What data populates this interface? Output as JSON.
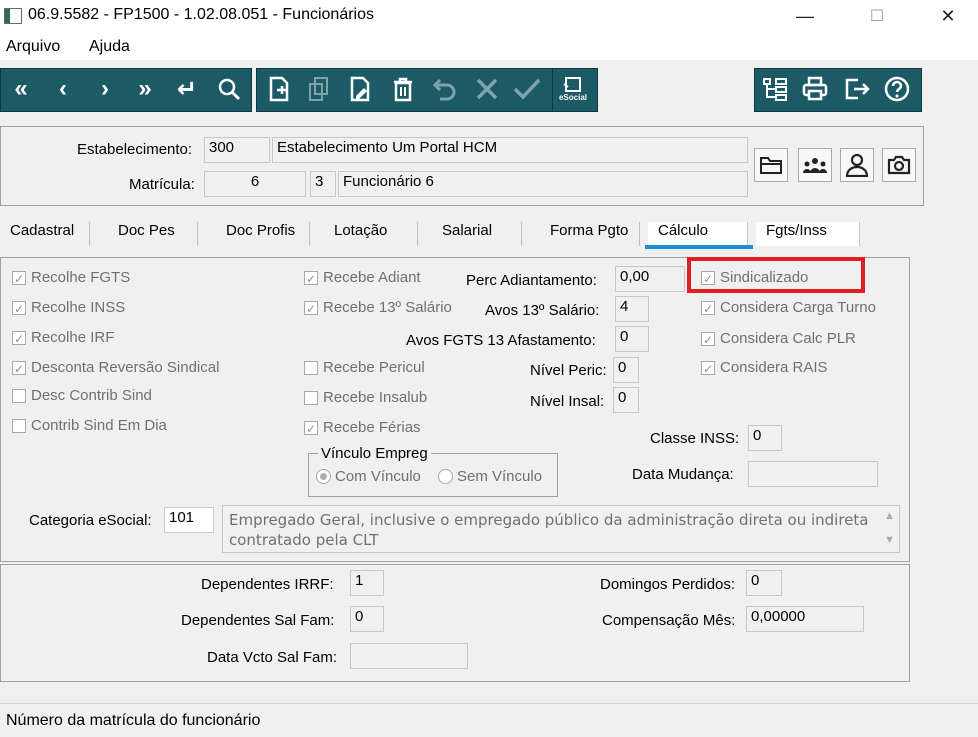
{
  "window": {
    "title": "06.9.5582 - FP1500 - 1.02.08.051 - Funcionários",
    "minimize": "—",
    "maximize": "☐",
    "close": "✕"
  },
  "menu": {
    "arquivo": "Arquivo",
    "ajuda": "Ajuda"
  },
  "toolbar": {
    "nav": [
      "«",
      "‹",
      "›",
      "»",
      "↵",
      "🔍"
    ],
    "edit": [
      "new-doc-icon",
      "copy-icon",
      "edit-icon",
      "delete-icon",
      "undo-icon",
      "cancel-icon",
      "confirm-icon"
    ],
    "esocial_label": "eSocial",
    "right": [
      "tree-icon",
      "print-icon",
      "exit-icon",
      "help-icon"
    ]
  },
  "header": {
    "estab_label": "Estabelecimento:",
    "estab_code": "300",
    "estab_name": "Estabelecimento Um Portal HCM",
    "matricula_label": "Matrícula:",
    "matricula": "6",
    "digit": "3",
    "func_name": "Funcionário 6"
  },
  "tabs": [
    "Cadastral",
    "Doc Pes",
    "Doc Profis",
    "Lotação",
    "Salarial",
    "Forma Pgto",
    "Cálculo",
    "Fgts/Inss"
  ],
  "calc": {
    "col1": [
      {
        "label": "Recolhe FGTS",
        "checked": true
      },
      {
        "label": "Recolhe INSS",
        "checked": true
      },
      {
        "label": "Recolhe IRF",
        "checked": true
      },
      {
        "label": "Desconta Reversão Sindical",
        "checked": true
      },
      {
        "label": "Desc Contrib Sind",
        "checked": false
      },
      {
        "label": "Contrib Sind Em Dia",
        "checked": false
      }
    ],
    "col2": [
      {
        "label": "Recebe Adiant",
        "checked": true
      },
      {
        "label": "Recebe 13º Salário",
        "checked": true
      },
      {
        "label": "Recebe Pericul",
        "checked": false
      },
      {
        "label": "Recebe Insalub",
        "checked": false
      },
      {
        "label": "Recebe Férias",
        "checked": true
      }
    ],
    "perc_label": "Perc Adiantamento:",
    "perc": "0,00",
    "avos13_label": "Avos 13º Salário:",
    "avos13": "4",
    "avosfgts_label": "Avos FGTS 13 Afastamento:",
    "avosfgts": "0",
    "nivel_peric_label": "Nível Peric:",
    "nivel_peric": "0",
    "nivel_insal_label": "Nível Insal:",
    "nivel_insal": "0",
    "col4": [
      {
        "label": "Sindicalizado",
        "checked": true
      },
      {
        "label": "Considera Carga Turno",
        "checked": true
      },
      {
        "label": "Considera Calc PLR",
        "checked": true
      },
      {
        "label": "Considera RAIS",
        "checked": true
      }
    ],
    "vinculo_title": "Vínculo Empreg",
    "com_vinculo": "Com Vínculo",
    "sem_vinculo": "Sem Vínculo",
    "classe_label": "Classe INSS:",
    "classe": "0",
    "data_mud_label": "Data Mudança:",
    "data_mud": "",
    "cat_label": "Categoria eSocial:",
    "cat_code": "101",
    "cat_desc": "Empregado  Geral, inclusive o empregado público da administração direta ou indireta contratado pela CLT"
  },
  "bottom": {
    "dep_irrf_label": "Dependentes IRRF:",
    "dep_irrf": "1",
    "dep_sal_label": "Dependentes Sal Fam:",
    "dep_sal": "0",
    "data_vcto_label": "Data Vcto Sal Fam:",
    "data_vcto": "",
    "dom_label": "Domingos Perdidos:",
    "dom": "0",
    "comp_label": "Compensação Mês:",
    "comp": "0,00000"
  },
  "status": "Número da matrícula do funcionário",
  "colors": {
    "toolbar": "#1c5a66",
    "highlight": "#e02020",
    "tab_underline": "#1a8fd8"
  }
}
